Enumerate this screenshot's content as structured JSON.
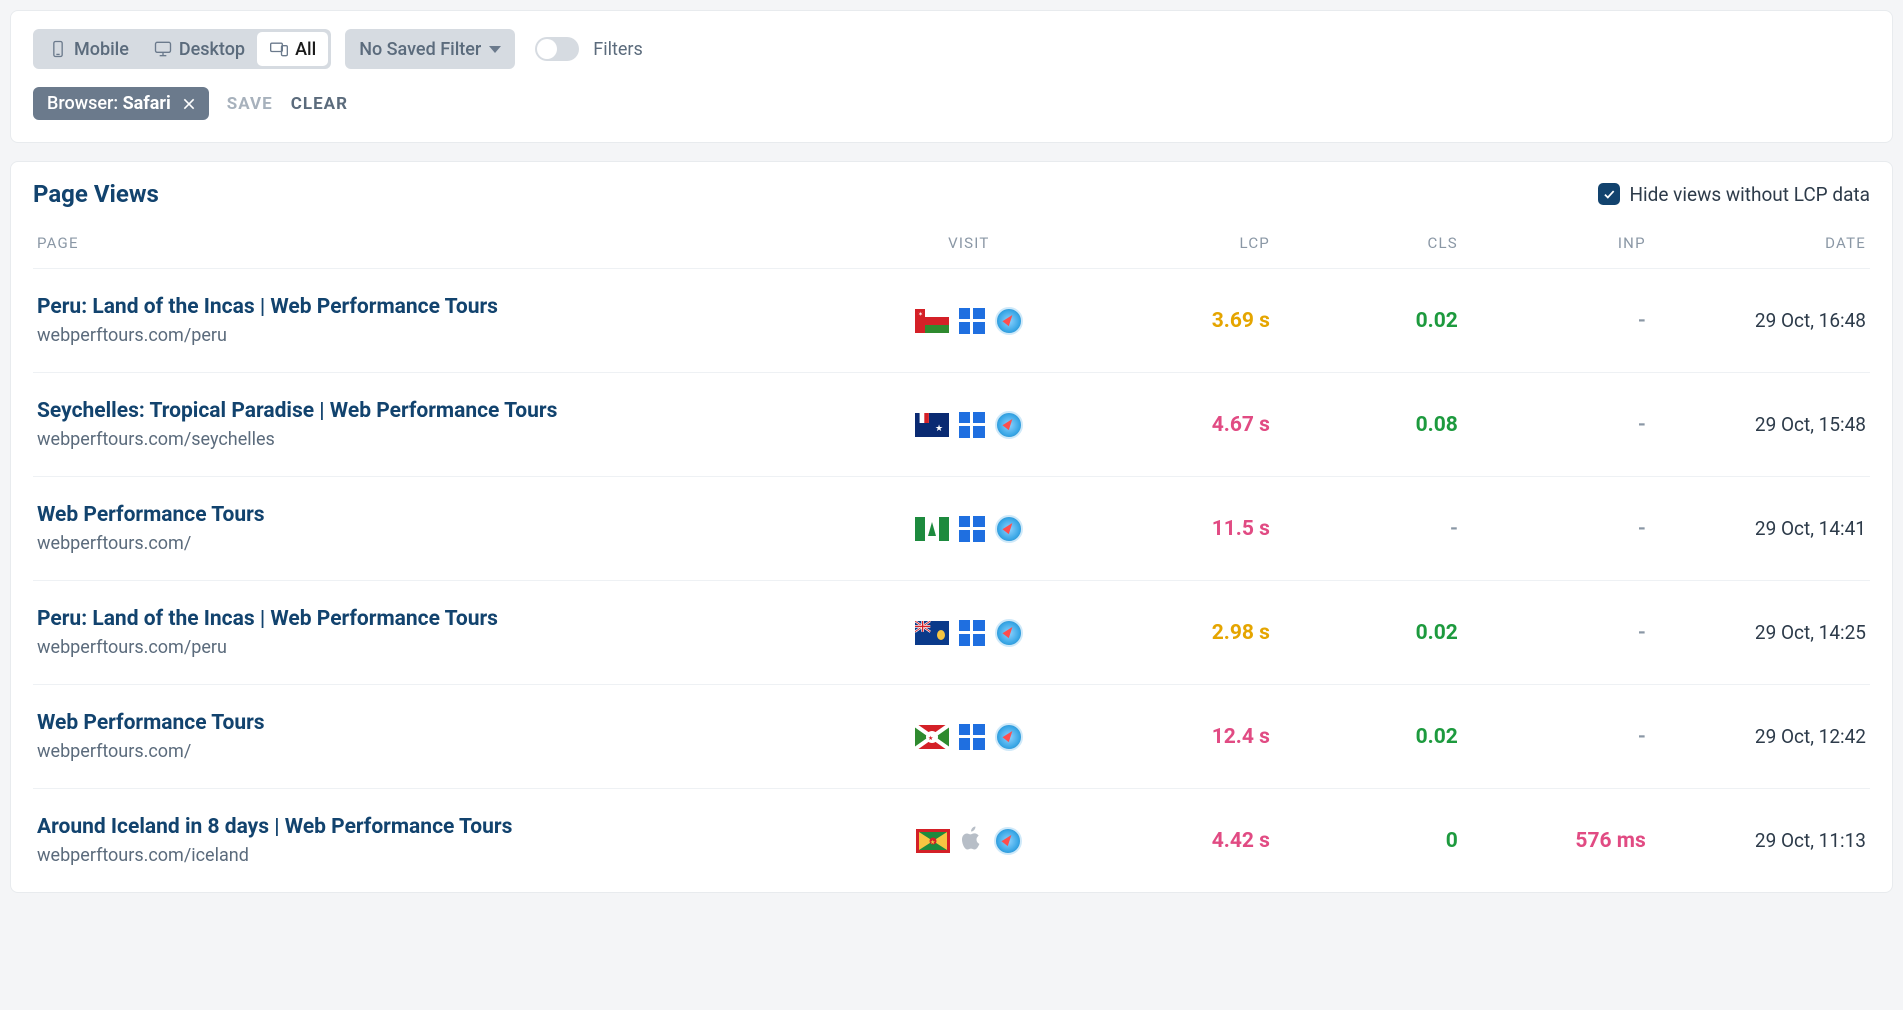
{
  "toolbar": {
    "device_tabs": {
      "mobile": "Mobile",
      "desktop": "Desktop",
      "all": "All"
    },
    "saved_filter_label": "No Saved Filter",
    "filters_label": "Filters",
    "chip": {
      "prefix": "Browser:",
      "value": "Safari"
    },
    "save_label": "SAVE",
    "clear_label": "CLEAR"
  },
  "section": {
    "title": "Page Views",
    "hide_label": "Hide views without LCP data"
  },
  "columns": {
    "page": "PAGE",
    "visit": "VISIT",
    "lcp": "LCP",
    "cls": "CLS",
    "inp": "INP",
    "date": "DATE"
  },
  "rows": [
    {
      "title": "Peru: Land of the Incas | Web Performance Tours",
      "url": "webperftours.com/peru",
      "flag": "oman",
      "os": "windows",
      "lcp": "3.69 s",
      "lcp_class": "amber",
      "cls": "0.02",
      "cls_class": "green",
      "inp": "-",
      "inp_class": "dim",
      "date": "29 Oct, 16:48"
    },
    {
      "title": "Seychelles: Tropical Paradise | Web Performance Tours",
      "url": "webperftours.com/seychelles",
      "flag": "taaf",
      "os": "windows",
      "lcp": "4.67 s",
      "lcp_class": "pink",
      "cls": "0.08",
      "cls_class": "green",
      "inp": "-",
      "inp_class": "dim",
      "date": "29 Oct, 15:48"
    },
    {
      "title": "Web Performance Tours",
      "url": "webperftours.com/",
      "flag": "norfolk",
      "os": "windows",
      "lcp": "11.5 s",
      "lcp_class": "pink",
      "cls": "-",
      "cls_class": "dim",
      "inp": "-",
      "inp_class": "dim",
      "date": "29 Oct, 14:41"
    },
    {
      "title": "Peru: Land of the Incas | Web Performance Tours",
      "url": "webperftours.com/peru",
      "flag": "tci",
      "os": "windows",
      "lcp": "2.98 s",
      "lcp_class": "amber",
      "cls": "0.02",
      "cls_class": "green",
      "inp": "-",
      "inp_class": "dim",
      "date": "29 Oct, 14:25"
    },
    {
      "title": "Web Performance Tours",
      "url": "webperftours.com/",
      "flag": "burundi",
      "os": "windows",
      "lcp": "12.4 s",
      "lcp_class": "pink",
      "cls": "0.02",
      "cls_class": "green",
      "inp": "-",
      "inp_class": "dim",
      "date": "29 Oct, 12:42"
    },
    {
      "title": "Around Iceland in 8 days | Web Performance Tours",
      "url": "webperftours.com/iceland",
      "flag": "grenada",
      "os": "apple",
      "lcp": "4.42 s",
      "lcp_class": "pink",
      "cls": "0",
      "cls_class": "green",
      "inp": "576 ms",
      "inp_class": "pink",
      "date": "29 Oct, 11:13"
    }
  ]
}
